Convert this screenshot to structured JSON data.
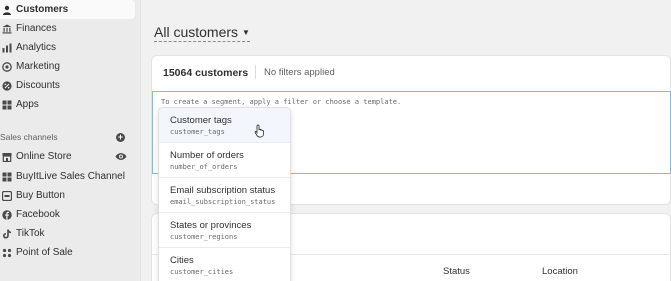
{
  "sidebar": {
    "items": [
      {
        "label": "Customers",
        "icon": "person-icon"
      },
      {
        "label": "Finances",
        "icon": "bank-icon"
      },
      {
        "label": "Analytics",
        "icon": "bar-chart-icon"
      },
      {
        "label": "Marketing",
        "icon": "target-icon"
      },
      {
        "label": "Discounts",
        "icon": "percent-icon"
      },
      {
        "label": "Apps",
        "icon": "grid-icon"
      }
    ],
    "sales_channels_label": "Sales channels",
    "channels": [
      {
        "label": "Online Store",
        "icon": "store-icon"
      },
      {
        "label": "BuyItLive Sales Channel",
        "icon": "buyitlive-icon"
      },
      {
        "label": "Buy Button",
        "icon": "buy-button-icon"
      },
      {
        "label": "Facebook",
        "icon": "facebook-icon"
      },
      {
        "label": "TikTok",
        "icon": "tiktok-icon"
      },
      {
        "label": "Point of Sale",
        "icon": "pos-icon"
      }
    ]
  },
  "header": {
    "title": "All customers"
  },
  "segment": {
    "count": "15064 customers",
    "filters": "No filters applied",
    "hint": "To create a segment, apply a filter or choose a template."
  },
  "dropdown": {
    "options": [
      {
        "label": "Customer tags",
        "key": "customer_tags"
      },
      {
        "label": "Number of orders",
        "key": "number_of_orders"
      },
      {
        "label": "Email subscription status",
        "key": "email_subscription_status"
      },
      {
        "label": "States or provinces",
        "key": "customer_regions"
      },
      {
        "label": "Cities",
        "key": "customer_cities"
      }
    ]
  },
  "table": {
    "columns": [
      "Status",
      "Location"
    ]
  },
  "colors": {
    "accent_border": "#8db6e6",
    "sidebar_bg": "#ebebeb",
    "page_bg": "#f1f1f1"
  }
}
